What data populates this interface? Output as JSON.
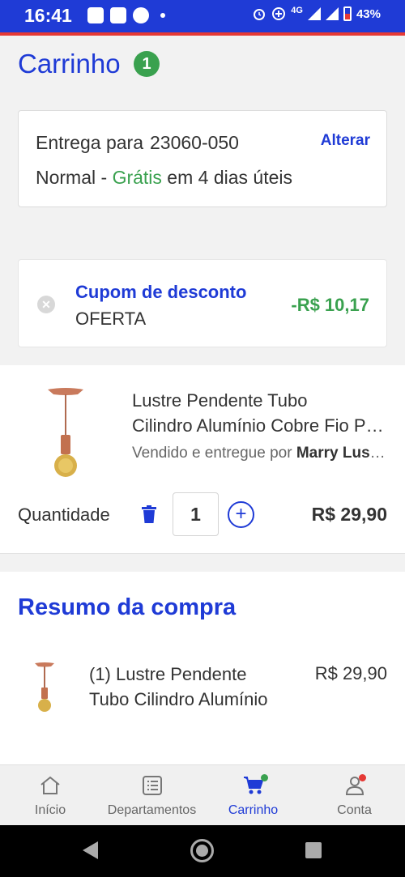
{
  "status_bar": {
    "time": "16:41",
    "network": "4G",
    "battery": "43%"
  },
  "header": {
    "title": "Carrinho",
    "count": "1"
  },
  "delivery": {
    "label": "Entrega para",
    "zip": "23060-050",
    "change_label": "Alterar",
    "method": "Normal -",
    "free_label": "Grátis",
    "eta": "em 4 dias úteis"
  },
  "coupon": {
    "title": "Cupom de desconto",
    "code": "OFERTA",
    "value": "-R$ 10,17"
  },
  "product": {
    "name_line1": "Lustre Pendente Tubo",
    "name_line2": "Cilindro Alumínio Cobre Fio Preto",
    "seller_prefix": "Vendido e entregue por",
    "seller_name": "Marry Lustres",
    "quantity_label": "Quantidade",
    "quantity": "1",
    "price": "R$ 29,90"
  },
  "summary": {
    "title": "Resumo da compra",
    "item_line1": "(1) Lustre Pendente",
    "item_line2": "Tubo Cilindro Alumínio",
    "item_price": "R$ 29,90"
  },
  "bottom_nav": {
    "items": [
      {
        "label": "Início",
        "icon": "home-icon"
      },
      {
        "label": "Departamentos",
        "icon": "list-icon"
      },
      {
        "label": "Carrinho",
        "icon": "cart-icon"
      },
      {
        "label": "Conta",
        "icon": "user-icon"
      }
    ],
    "active": "Carrinho"
  },
  "colors": {
    "brand": "#1f3bd6",
    "success": "#3aa14f",
    "alert": "#e53935"
  }
}
